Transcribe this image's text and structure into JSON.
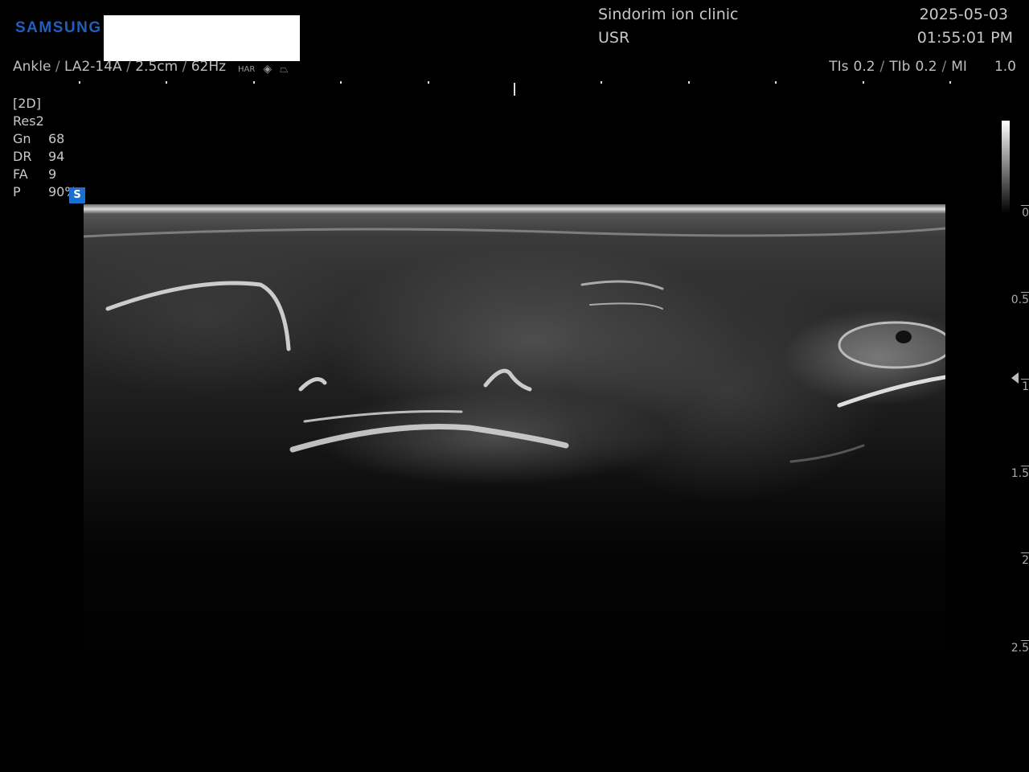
{
  "header": {
    "brand": "SAMSUNG",
    "clinic": "Sindorim ion clinic",
    "user": "USR",
    "date": "2025-05-03",
    "time": "01:55:01 PM"
  },
  "probe_line": {
    "preset": "Ankle",
    "probe": "LA2-14A",
    "depth": "2.5cm",
    "frame_rate": "62Hz",
    "har_label": "HAR",
    "icons": [
      "eye-icon",
      "trapezoid-icon"
    ]
  },
  "thermal": {
    "tis_label": "TIs",
    "tis": "0.2",
    "tib_label": "TIb",
    "tib": "0.2",
    "mi_label": "MI",
    "mi": "1.0",
    "sep": "/"
  },
  "params": {
    "mode": "[2D]",
    "res": "Res2",
    "rows": [
      {
        "k": "Gn",
        "v": "68"
      },
      {
        "k": "DR",
        "v": "94"
      },
      {
        "k": "FA",
        "v": "9"
      },
      {
        "k": "P",
        "v": "90%"
      }
    ],
    "badge": "S"
  },
  "depth_scale": {
    "unit_marks": [
      "0",
      "0.5",
      "1",
      "1.5",
      "2",
      "2.5"
    ],
    "focus_depth": "1"
  }
}
